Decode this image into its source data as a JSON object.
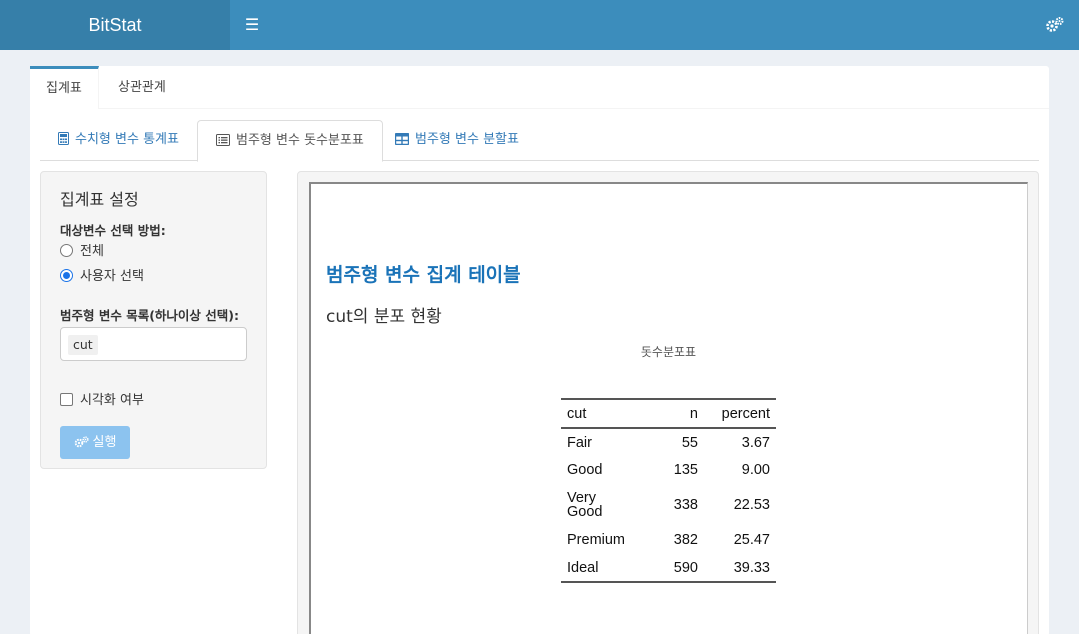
{
  "header": {
    "app_title": "BitStat",
    "menu_icon": "hamburger-icon",
    "settings_icon": "gears-icon",
    "color": "#3c8dbc"
  },
  "top_tabs": [
    {
      "label": "집계표",
      "active": true
    },
    {
      "label": "상관관계",
      "active": false
    }
  ],
  "sub_tabs": [
    {
      "label": "수치형 변수 통계표",
      "icon": "calculator-icon",
      "active": false
    },
    {
      "label": "범주형 변수 돗수분포표",
      "icon": "list-alt-icon",
      "active": true
    },
    {
      "label": "범주형 변수 분할표",
      "icon": "table-icon",
      "active": false
    }
  ],
  "sidebar": {
    "title": "집계표 설정",
    "method_label": "대상변수 선택 방법:",
    "method_options": [
      {
        "label": "전체",
        "selected": false
      },
      {
        "label": "사용자 선택",
        "selected": true
      }
    ],
    "variables_label": "범주형 변수 목록(하나이상 선택):",
    "selected_variable": "cut",
    "visualize_label": "시각화 여부",
    "visualize_checked": false,
    "run_label": "실행"
  },
  "report": {
    "heading": "범주형 변수 집계 테이블",
    "subheading": "cut의 분포 현황",
    "caption": "돗수분포표",
    "columns": [
      "cut",
      "n",
      "percent"
    ],
    "rows": [
      [
        "Fair",
        "55",
        "3.67"
      ],
      [
        "Good",
        "135",
        "9.00"
      ],
      [
        "Very Good",
        "338",
        "22.53"
      ],
      [
        "Premium",
        "382",
        "25.47"
      ],
      [
        "Ideal",
        "590",
        "39.33"
      ]
    ],
    "accent_color": "#1a73b8"
  }
}
